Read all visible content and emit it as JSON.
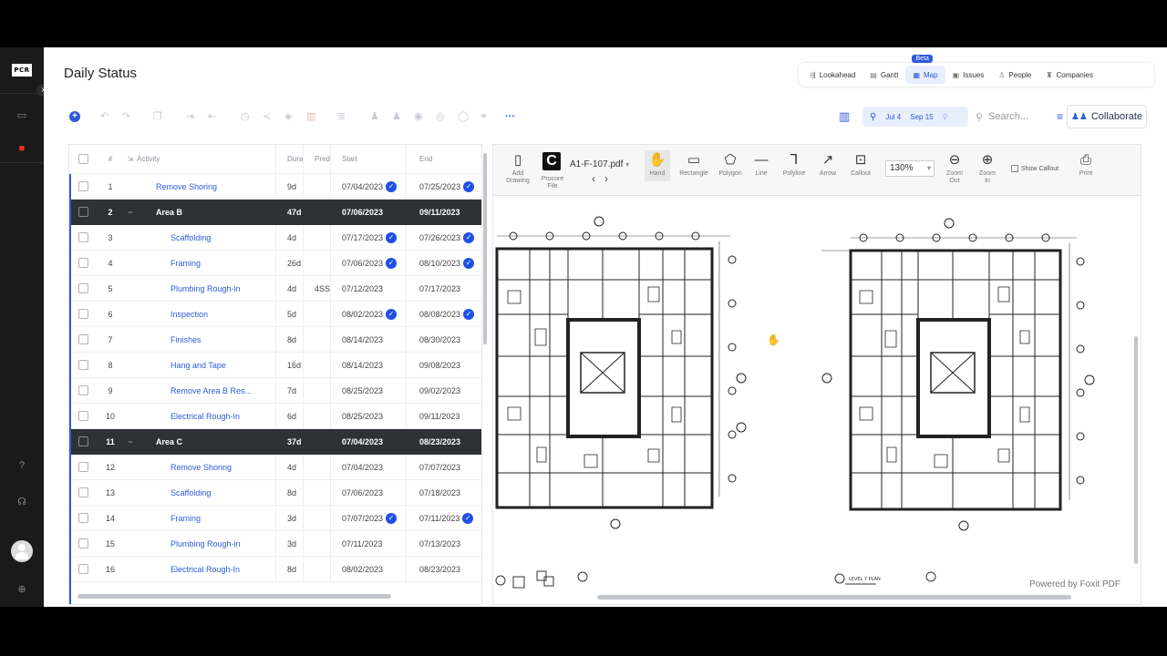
{
  "rail": {
    "logo": "PCR",
    "icons": [
      "folder-icon",
      "projects-icon",
      "help-icon",
      "headset-icon",
      "user-icon",
      "globe-icon"
    ]
  },
  "page": {
    "title": "Daily Status"
  },
  "view_tabs": {
    "beta": "Beta",
    "items": [
      "Lookahead",
      "Gantt",
      "Map",
      "Issues",
      "People",
      "Companies"
    ]
  },
  "toolbar": {
    "date_from": "Jul 4",
    "date_to": "Sep 15",
    "search_placeholder": "Search...",
    "collaborate": "Collaborate"
  },
  "grid": {
    "columns": {
      "num": "#",
      "activity": "Activity",
      "dur": "Dura",
      "pred": "Pred",
      "start": "Start",
      "end": "End"
    },
    "rows": [
      {
        "num": "1",
        "activity": "Remove Shoring",
        "dur": "9d",
        "pred": "",
        "start": "07/04/2023",
        "end": "07/25/2023",
        "level": 0,
        "group": false,
        "start_check": true,
        "end_check": true
      },
      {
        "num": "2",
        "activity": "Area B",
        "dur": "47d",
        "pred": "",
        "start": "07/06/2023",
        "end": "09/11/2023",
        "level": 0,
        "group": true,
        "start_check": false,
        "end_check": false
      },
      {
        "num": "3",
        "activity": "Scaffolding",
        "dur": "4d",
        "pred": "",
        "start": "07/17/2023",
        "end": "07/26/2023",
        "level": 1,
        "group": false,
        "start_check": true,
        "end_check": true
      },
      {
        "num": "4",
        "activity": "Framing",
        "dur": "26d",
        "pred": "",
        "start": "07/06/2023",
        "end": "08/10/2023",
        "level": 1,
        "group": false,
        "start_check": true,
        "end_check": true
      },
      {
        "num": "5",
        "activity": "Plumbing Rough-in",
        "dur": "4d",
        "pred": "4SS",
        "start": "07/12/2023",
        "end": "07/17/2023",
        "level": 1,
        "group": false,
        "start_check": false,
        "end_check": false
      },
      {
        "num": "6",
        "activity": "Inspection",
        "dur": "5d",
        "pred": "",
        "start": "08/02/2023",
        "end": "08/08/2023",
        "level": 1,
        "group": false,
        "start_check": true,
        "end_check": true
      },
      {
        "num": "7",
        "activity": "Finishes",
        "dur": "8d",
        "pred": "",
        "start": "08/14/2023",
        "end": "08/30/2023",
        "level": 1,
        "group": false,
        "start_check": false,
        "end_check": false
      },
      {
        "num": "8",
        "activity": "Hang and Tape",
        "dur": "16d",
        "pred": "",
        "start": "08/14/2023",
        "end": "09/08/2023",
        "level": 1,
        "group": false,
        "start_check": false,
        "end_check": false
      },
      {
        "num": "9",
        "activity": "Remove Area B Res...",
        "dur": "7d",
        "pred": "",
        "start": "08/25/2023",
        "end": "09/02/2023",
        "level": 1,
        "group": false,
        "start_check": false,
        "end_check": false
      },
      {
        "num": "10",
        "activity": "Electrical Rough-In",
        "dur": "6d",
        "pred": "",
        "start": "08/25/2023",
        "end": "09/11/2023",
        "level": 1,
        "group": false,
        "start_check": false,
        "end_check": false
      },
      {
        "num": "11",
        "activity": "Area C",
        "dur": "37d",
        "pred": "",
        "start": "07/04/2023",
        "end": "08/23/2023",
        "level": 0,
        "group": true,
        "start_check": false,
        "end_check": false
      },
      {
        "num": "12",
        "activity": "Remove Shoring",
        "dur": "4d",
        "pred": "",
        "start": "07/04/2023",
        "end": "07/07/2023",
        "level": 1,
        "group": false,
        "start_check": false,
        "end_check": false
      },
      {
        "num": "13",
        "activity": "Scaffolding",
        "dur": "8d",
        "pred": "",
        "start": "07/06/2023",
        "end": "07/18/2023",
        "level": 1,
        "group": false,
        "start_check": false,
        "end_check": false
      },
      {
        "num": "14",
        "activity": "Framing",
        "dur": "3d",
        "pred": "",
        "start": "07/07/2023",
        "end": "07/11/2023",
        "level": 1,
        "group": false,
        "start_check": true,
        "end_check": true
      },
      {
        "num": "15",
        "activity": "Plumbing Rough-in",
        "dur": "3d",
        "pred": "",
        "start": "07/11/2023",
        "end": "07/13/2023",
        "level": 1,
        "group": false,
        "start_check": false,
        "end_check": false
      },
      {
        "num": "16",
        "activity": "Electrical Rough-In",
        "dur": "8d",
        "pred": "",
        "start": "08/02/2023",
        "end": "08/23/2023",
        "level": 1,
        "group": false,
        "start_check": false,
        "end_check": false
      }
    ]
  },
  "viewer": {
    "tools": {
      "add_drawing": "Add Drawing",
      "procore_file": "Procore File",
      "file_name": "A1-F-107.pdf",
      "hand": "Hand",
      "rectangle": "Rectangle",
      "polygon": "Polygon",
      "line": "Line",
      "polyline": "Polyline",
      "arrow": "Arrow",
      "callout": "Callout",
      "zoom_value": "130%",
      "zoom_out": "Zoom Out",
      "zoom_in": "Zoom In",
      "show_callout": "Show Callout",
      "print": "Print"
    },
    "plan_label": "LEVEL 7 PLAN",
    "powered_by": "Powered by Foxit PDF"
  },
  "colors": {
    "accent": "#2d5bd8",
    "group_row": "#2f3137",
    "check_badge": "#1f50e6"
  }
}
